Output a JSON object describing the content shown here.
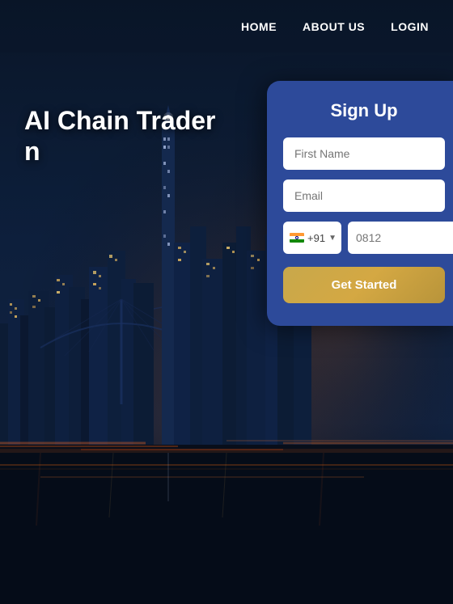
{
  "navbar": {
    "links": [
      {
        "label": "HOME",
        "id": "home"
      },
      {
        "label": "ABOUT US",
        "id": "about"
      },
      {
        "label": "LOGIN",
        "id": "login"
      }
    ]
  },
  "hero": {
    "title_line1": "AI Chain Trader",
    "title_line2": "n"
  },
  "signup": {
    "title": "Sig",
    "title_full": "Sign Up",
    "first_name_placeholder": "First Name",
    "email_placeholder": "Email",
    "phone_prefix": "+91",
    "phone_placeholder": "0812",
    "submit_label": "Get Started"
  }
}
